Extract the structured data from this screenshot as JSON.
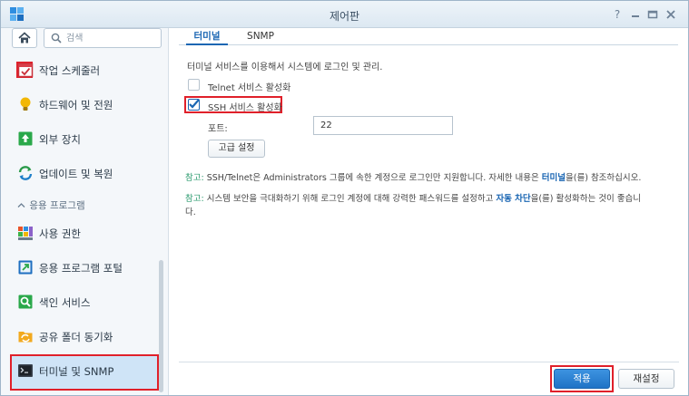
{
  "window": {
    "title": "제어판"
  },
  "sidebar": {
    "search_placeholder": "검색",
    "section_header": "응용 프로그램",
    "items": [
      {
        "label": "작업 스케줄러",
        "icon": "task-scheduler-icon"
      },
      {
        "label": "하드웨어 및 전원",
        "icon": "lightbulb-icon"
      },
      {
        "label": "외부 장치",
        "icon": "external-device-icon"
      },
      {
        "label": "업데이트 및 복원",
        "icon": "update-restore-icon"
      },
      {
        "label": "사용 권한",
        "icon": "privileges-icon"
      },
      {
        "label": "응용 프로그램 포털",
        "icon": "app-portal-icon"
      },
      {
        "label": "색인 서비스",
        "icon": "indexing-icon"
      },
      {
        "label": "공유 폴더 동기화",
        "icon": "folder-sync-icon"
      },
      {
        "label": "터미널 및 SNMP",
        "icon": "terminal-icon",
        "active": true
      }
    ]
  },
  "tabs": [
    {
      "label": "터미널",
      "active": true
    },
    {
      "label": "SNMP",
      "active": false
    }
  ],
  "terminal": {
    "description": "터미널 서비스를 이용해서 시스템에 로그인 및 관리.",
    "telnet_label": "Telnet 서비스 활성화",
    "telnet_checked": false,
    "ssh_label": "SSH 서비스 활성화",
    "ssh_checked": true,
    "port_label": "포트:",
    "port_value": "22",
    "advanced_button": "고급 설정",
    "note1_prefix": "참고:",
    "note1_text": " SSH/Telnet은 Administrators 그룹에 속한 계정으로 로그인만 지원합니다. 자세한 내용은 ",
    "note1_link": "터미널",
    "note1_suffix": "을(를) 참조하십시오.",
    "note2_prefix": "참고:",
    "note2_text": " 시스템 보안을 극대화하기 위해 로그인 계정에 대해 강력한 패스워드를 설정하고 ",
    "note2_link": "자동 차단",
    "note2_suffix": "을(를) 활성화하는 것이 좋습니",
    "note2_cont": "다."
  },
  "footer": {
    "apply_label": "적용",
    "reset_label": "재설정"
  },
  "colors": {
    "accent": "#1a66b3",
    "highlight": "#e0202a",
    "note_prefix": "#2b9a6e"
  }
}
